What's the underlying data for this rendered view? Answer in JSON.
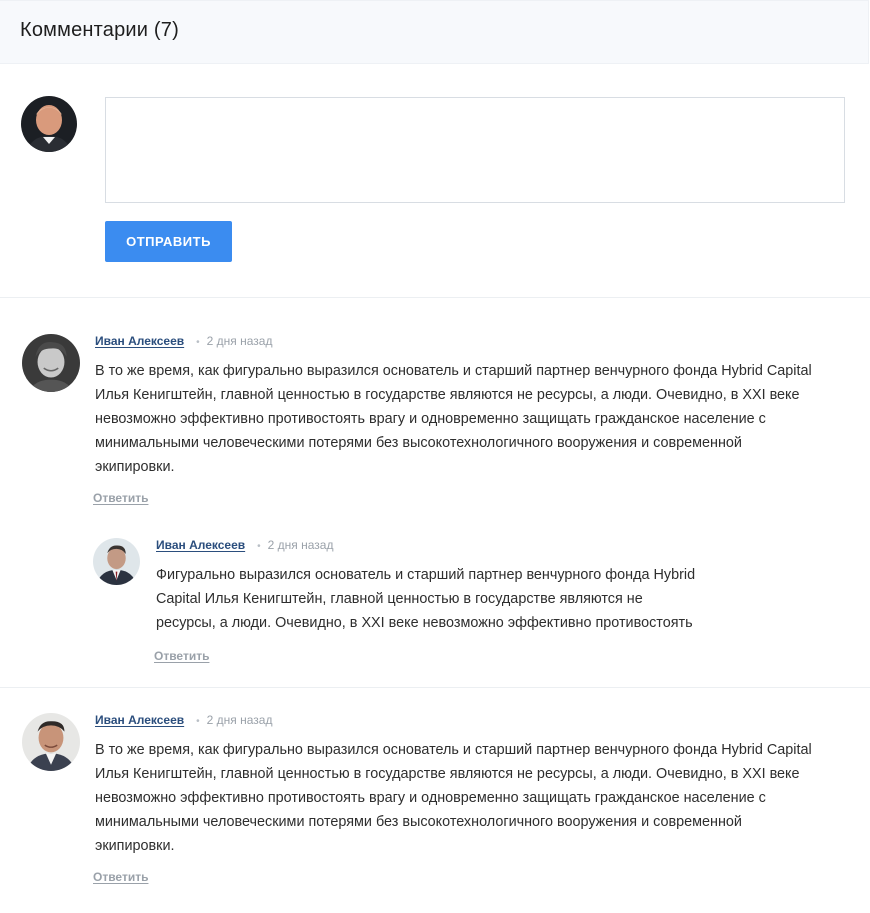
{
  "header": {
    "title": "Комментарии (7)"
  },
  "compose": {
    "placeholder": "",
    "submit_label": "ОТПРАВИТЬ"
  },
  "comments": [
    {
      "author": "Иван Алексеев",
      "time": "2 дня назад",
      "lines": [
        "В то же время, как фигурально выразился основатель и старший партнер венчурного фонда Hybrid Capital",
        "Илья Кенигштейн, главной ценностью в государстве являются не ресурсы, а люди. Очевидно, в XXI веке",
        "невозможно эффективно противостоять врагу и одновременно защищать гражданское население с",
        "минимальными человеческими потерями без высокотехнологичного вооружения и современной",
        "экипировки."
      ],
      "reply_label": "Ответить"
    },
    {
      "author": "Иван Алексеев",
      "time": "2 дня назад",
      "lines": [
        "Фигурально выразился основатель и старший партнер венчурного фонда Hybrid",
        "Capital Илья Кенигштейн, главной ценностью в государстве являются не",
        "ресурсы, а люди. Очевидно, в XXI веке невозможно эффективно противостоять"
      ],
      "reply_label": "Ответить"
    },
    {
      "author": "Иван Алексеев",
      "time": "2 дня назад",
      "lines": [
        "В то же время, как фигурально выразился основатель и старший партнер венчурного фонда Hybrid Capital",
        "Илья Кенигштейн, главной ценностью в государстве являются не ресурсы, а люди. Очевидно, в XXI веке",
        "невозможно эффективно противостоять врагу и одновременно защищать гражданское население с",
        "минимальными человеческими потерями без высокотехнологичного вооружения и современной",
        "экипировки."
      ],
      "reply_label": "Ответить"
    }
  ],
  "colors": {
    "accent": "#3b8cf0",
    "author": "#2b4e7d",
    "muted": "#9aa1a9"
  }
}
